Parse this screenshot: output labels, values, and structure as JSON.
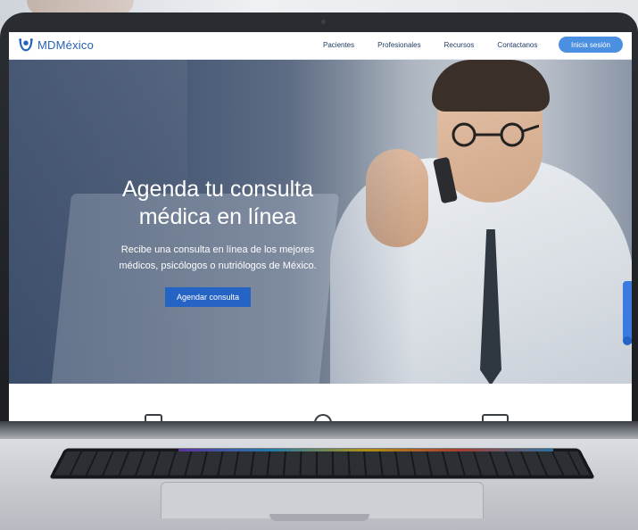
{
  "brand": {
    "name": "MDMéxico",
    "color": "#2563b8"
  },
  "nav": {
    "links": [
      "Pacientes",
      "Profesionales",
      "Recursos",
      "Contactanos"
    ],
    "login_label": "Inicia sesión",
    "login_color": "#4a8fe0"
  },
  "hero": {
    "title_line1": "Agenda tu consulta",
    "title_line2": "médica en línea",
    "subtitle_line1": "Recibe una consulta en línea de los mejores",
    "subtitle_line2": "médicos, psicólogos o nutriólogos de México.",
    "cta_label": "Agendar consulta",
    "cta_color": "#2563c4"
  },
  "icons": [
    "logo-icon",
    "chat-icon",
    "calendar-icon",
    "medical-bag-icon",
    "phone-icon"
  ]
}
